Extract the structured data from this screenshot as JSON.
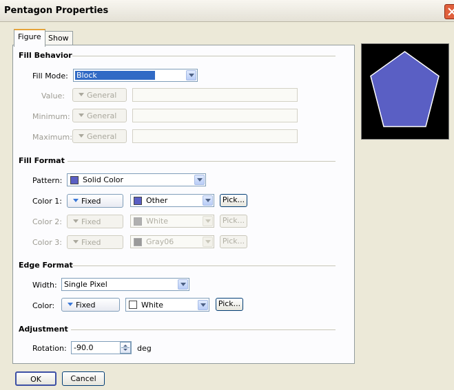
{
  "window": {
    "title": "Pentagon Properties"
  },
  "tabs": [
    {
      "label": "Figure"
    },
    {
      "label": "Show"
    }
  ],
  "fill_behavior": {
    "heading": "Fill Behavior",
    "fill_mode_label": "Fill Mode:",
    "fill_mode_value": "Block",
    "value_label": "Value:",
    "minimum_label": "Minimum:",
    "maximum_label": "Maximum:",
    "general_label": "General"
  },
  "fill_format": {
    "heading": "Fill Format",
    "pattern_label": "Pattern:",
    "pattern_value": "Solid Color",
    "pattern_swatch_color": "#5a5fc4",
    "color1_label": "Color 1:",
    "color1_mode": "Fixed",
    "color1_value": "Other",
    "color1_swatch": "#5a5fc4",
    "color2_label": "Color 2:",
    "color2_mode": "Fixed",
    "color2_value": "White",
    "color2_swatch": "#b0b0b0",
    "color3_label": "Color 3:",
    "color3_mode": "Fixed",
    "color3_value": "Gray06",
    "color3_swatch": "#9a9a9a",
    "pick_label": "Pick..."
  },
  "edge_format": {
    "heading": "Edge Format",
    "width_label": "Width:",
    "width_value": "Single Pixel",
    "color_label": "Color:",
    "color_mode": "Fixed",
    "color_value": "White",
    "color_swatch": "#ffffff",
    "pick_label": "Pick..."
  },
  "adjustment": {
    "heading": "Adjustment",
    "rotation_label": "Rotation:",
    "rotation_value": "-90.0",
    "unit": "deg"
  },
  "preview": {
    "shape_fill": "#5a5fc4",
    "shape_edge": "#ffffff",
    "background": "#000000"
  },
  "footer": {
    "ok_label": "OK",
    "cancel_label": "Cancel"
  }
}
